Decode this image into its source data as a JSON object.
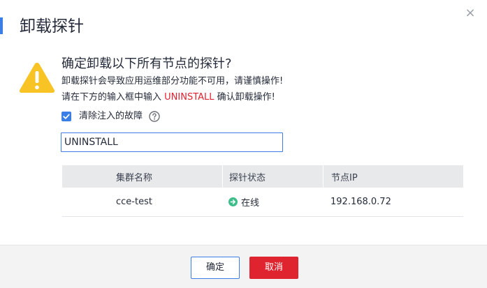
{
  "dialog": {
    "title": "卸载探针",
    "close_label": "×",
    "question": "确定卸载以下所有节点的探针?",
    "warning_line": "卸载探针会导致应用运维部分功能不可用，请谨慎操作!",
    "instruction_prefix": "请在下方的输入框中输入 ",
    "instruction_keyword": "UNINSTALL",
    "instruction_suffix": " 确认卸载操作!",
    "checkbox_label": "清除注入的故障",
    "checkbox_checked": true,
    "input_value": "UNINSTALL",
    "icons": {
      "warning": "warning-triangle-icon",
      "help": "question-circle-icon",
      "status": "arrow-right-circle-icon",
      "close": "close-icon"
    },
    "colors": {
      "accent": "#3a7ee6",
      "danger": "#e0242f",
      "warning": "#f7c325",
      "online": "#3dbd8a"
    }
  },
  "table": {
    "headers": [
      "集群名称",
      "探针状态",
      "节点IP"
    ],
    "rows": [
      {
        "cluster": "cce-test",
        "status": "在线",
        "ip": "192.168.0.72"
      }
    ]
  },
  "footer": {
    "ok_label": "确定",
    "cancel_label": "取消"
  }
}
